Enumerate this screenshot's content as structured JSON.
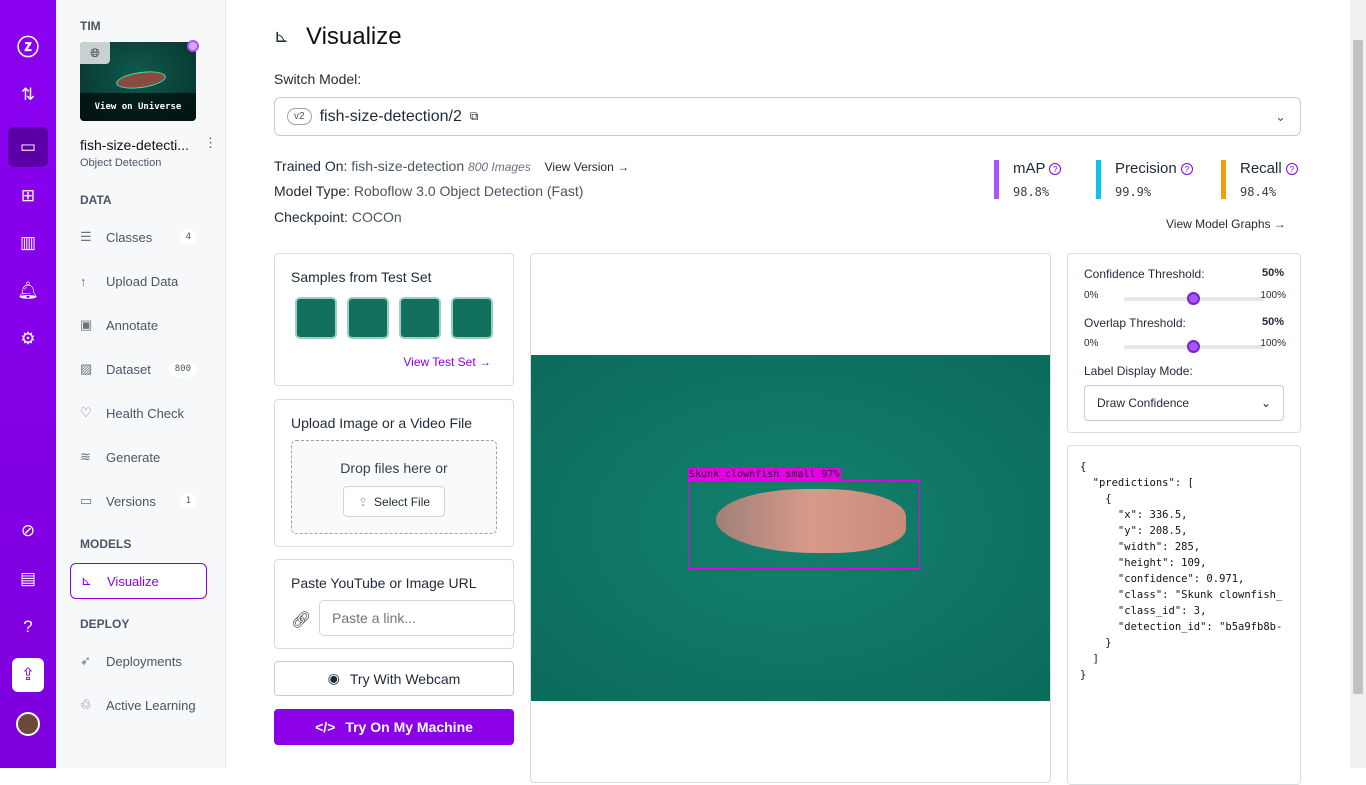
{
  "rail": {
    "icons": [
      "roboflow-logo-icon",
      "sort-arrows-icon",
      "inbox-icon",
      "workflow-icon",
      "analytics-icon",
      "bell-icon",
      "gear-icon",
      "compass-icon",
      "library-icon",
      "help-icon",
      "upload-icon",
      "avatar"
    ]
  },
  "sidebar": {
    "workspace": "TIM",
    "view_universe": "View on Universe",
    "project_name": "fish-size-detecti...",
    "project_type": "Object Detection",
    "data_header": "DATA",
    "models_header": "MODELS",
    "deploy_header": "DEPLOY",
    "items": [
      {
        "label": "Classes",
        "badge": "4"
      },
      {
        "label": "Upload Data"
      },
      {
        "label": "Annotate"
      },
      {
        "label": "Dataset",
        "badge": "800"
      },
      {
        "label": "Health Check"
      },
      {
        "label": "Generate"
      },
      {
        "label": "Versions",
        "badge": "1"
      },
      {
        "label": "Visualize"
      },
      {
        "label": "Deployments"
      },
      {
        "label": "Active Learning"
      }
    ]
  },
  "header": {
    "title": "Visualize",
    "switch_label": "Switch Model:",
    "version_badge": "v2",
    "model": "fish-size-detection/2"
  },
  "info": {
    "trained_on_label": "Trained On:",
    "trained_on": "fish-size-detection",
    "images": "800 Images",
    "view_version": "View Version →",
    "model_type_label": "Model Type:",
    "model_type": "Roboflow 3.0 Object Detection (Fast)",
    "checkpoint_label": "Checkpoint:",
    "checkpoint": "COCOn"
  },
  "metrics": [
    {
      "name": "mAP",
      "value": "98.8%",
      "color": "#a855f7"
    },
    {
      "name": "Precision",
      "value": "99.9%",
      "color": "#0ec1f0"
    },
    {
      "name": "Recall",
      "value": "98.4%",
      "color": "#f59e0b"
    }
  ],
  "view_graphs": "View Model Graphs →",
  "samples": {
    "title": "Samples from Test Set",
    "link": "View Test Set →"
  },
  "upload": {
    "title": "Upload Image or a Video File",
    "drop": "Drop files here or",
    "select": "Select File"
  },
  "paste": {
    "title": "Paste YouTube or Image URL",
    "placeholder": "Paste a link..."
  },
  "webcam": "Try With Webcam",
  "machine": "Try On My Machine",
  "detection": {
    "label": "Skunk_clownfish_small 97%"
  },
  "controls": {
    "confidence_label": "Confidence Threshold:",
    "confidence": "50%",
    "overlap_label": "Overlap Threshold:",
    "overlap": "50%",
    "min": "0%",
    "max": "100%",
    "display_label": "Label Display Mode:",
    "display_value": "Draw Confidence",
    "confidence_fraction": 0.5,
    "overlap_fraction": 0.5
  },
  "json_output": "{\n  \"predictions\": [\n    {\n      \"x\": 336.5,\n      \"y\": 208.5,\n      \"width\": 285,\n      \"height\": 109,\n      \"confidence\": 0.971,\n      \"class\": \"Skunk clownfish_\n      \"class_id\": 3,\n      \"detection_id\": \"b5a9fb8b-\n    }\n  ]\n}",
  "colors": {
    "accent": "#8b00e6",
    "box": "#e600e6",
    "water": "#0f7a68"
  }
}
